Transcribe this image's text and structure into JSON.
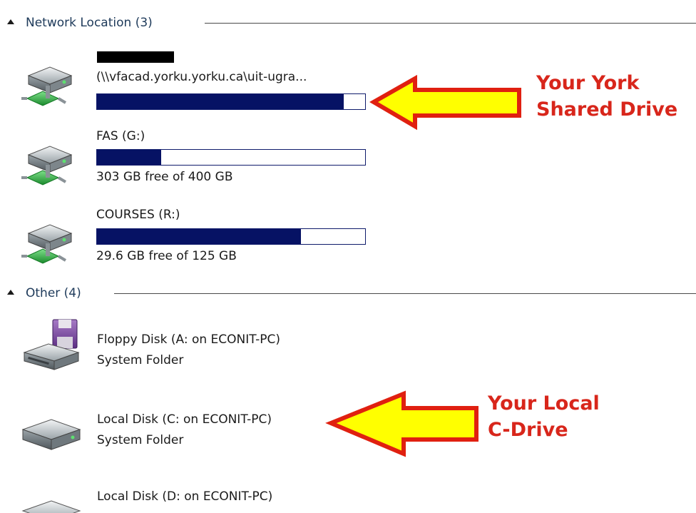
{
  "groups": {
    "network": {
      "title": "Network Location (3)"
    },
    "other": {
      "title": "Other (4)"
    }
  },
  "network_items": [
    {
      "name": "(\\\\vfacad.yorku.yorku.ca\\uit-ugra...",
      "free_text": "",
      "used_fraction": 0.92
    },
    {
      "name": "FAS (G:)",
      "free_text": "303 GB free of 400 GB",
      "used_fraction": 0.24
    },
    {
      "name": "COURSES (R:)",
      "free_text": "29.6 GB free of 125 GB",
      "used_fraction": 0.76
    }
  ],
  "other_items": [
    {
      "name": "Floppy Disk (A: on ECONIT-PC)",
      "subtitle": "System Folder"
    },
    {
      "name": "Local Disk (C: on ECONIT-PC)",
      "subtitle": "System Folder"
    },
    {
      "name": "Local Disk (D: on ECONIT-PC)",
      "subtitle": ""
    }
  ],
  "annotations": {
    "york_line1": "Your York",
    "york_line2": "Shared Drive",
    "local_line1": "Your Local",
    "local_line2": "C-Drive"
  },
  "colors": {
    "bar_fill": "#061264",
    "callout_text": "#d8261b",
    "arrow_fill": "#ffff00",
    "arrow_stroke": "#e02010"
  },
  "icons": {
    "network_drive": "network-drive-icon",
    "floppy": "floppy-disk-icon",
    "local_disk": "hard-disk-icon",
    "collapse": "collapse-triangle-icon",
    "redaction": "redaction-bar"
  }
}
